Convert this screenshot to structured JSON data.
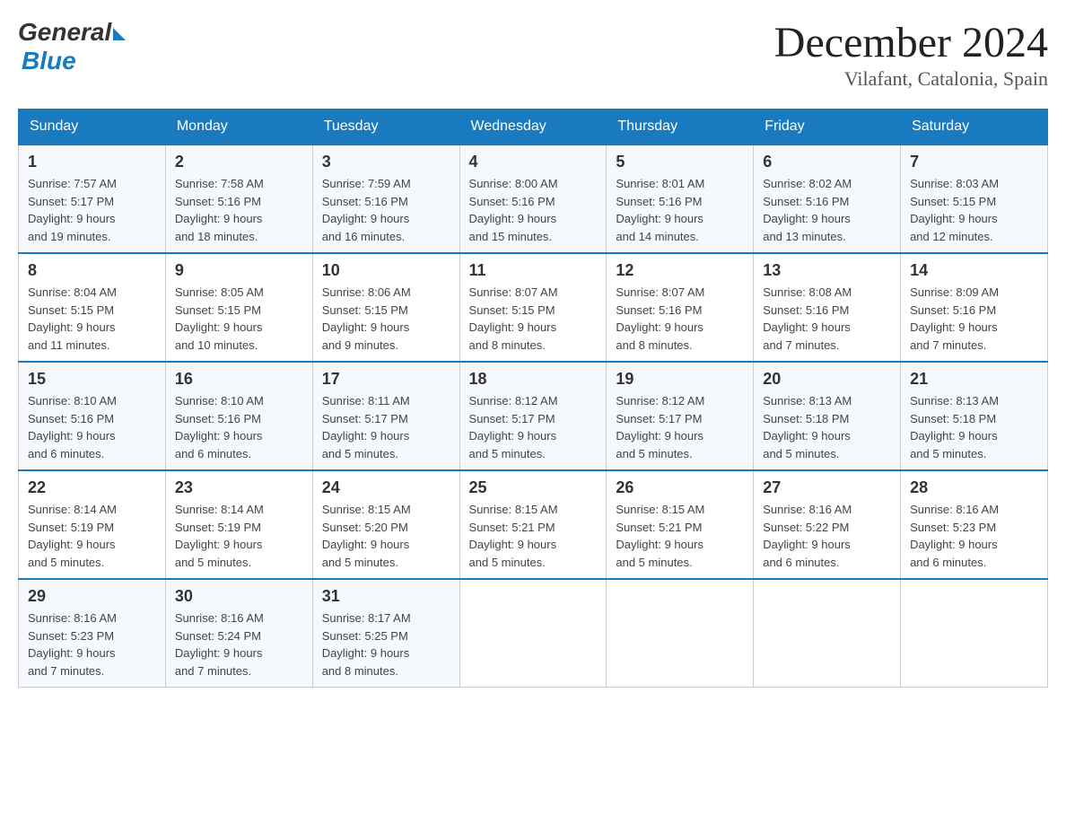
{
  "header": {
    "logo_general": "General",
    "logo_blue": "Blue",
    "month_title": "December 2024",
    "location": "Vilafant, Catalonia, Spain"
  },
  "weekdays": [
    "Sunday",
    "Monday",
    "Tuesday",
    "Wednesday",
    "Thursday",
    "Friday",
    "Saturday"
  ],
  "weeks": [
    [
      {
        "day": "1",
        "sunrise": "7:57 AM",
        "sunset": "5:17 PM",
        "daylight": "9 hours and 19 minutes."
      },
      {
        "day": "2",
        "sunrise": "7:58 AM",
        "sunset": "5:16 PM",
        "daylight": "9 hours and 18 minutes."
      },
      {
        "day": "3",
        "sunrise": "7:59 AM",
        "sunset": "5:16 PM",
        "daylight": "9 hours and 16 minutes."
      },
      {
        "day": "4",
        "sunrise": "8:00 AM",
        "sunset": "5:16 PM",
        "daylight": "9 hours and 15 minutes."
      },
      {
        "day": "5",
        "sunrise": "8:01 AM",
        "sunset": "5:16 PM",
        "daylight": "9 hours and 14 minutes."
      },
      {
        "day": "6",
        "sunrise": "8:02 AM",
        "sunset": "5:16 PM",
        "daylight": "9 hours and 13 minutes."
      },
      {
        "day": "7",
        "sunrise": "8:03 AM",
        "sunset": "5:15 PM",
        "daylight": "9 hours and 12 minutes."
      }
    ],
    [
      {
        "day": "8",
        "sunrise": "8:04 AM",
        "sunset": "5:15 PM",
        "daylight": "9 hours and 11 minutes."
      },
      {
        "day": "9",
        "sunrise": "8:05 AM",
        "sunset": "5:15 PM",
        "daylight": "9 hours and 10 minutes."
      },
      {
        "day": "10",
        "sunrise": "8:06 AM",
        "sunset": "5:15 PM",
        "daylight": "9 hours and 9 minutes."
      },
      {
        "day": "11",
        "sunrise": "8:07 AM",
        "sunset": "5:15 PM",
        "daylight": "9 hours and 8 minutes."
      },
      {
        "day": "12",
        "sunrise": "8:07 AM",
        "sunset": "5:16 PM",
        "daylight": "9 hours and 8 minutes."
      },
      {
        "day": "13",
        "sunrise": "8:08 AM",
        "sunset": "5:16 PM",
        "daylight": "9 hours and 7 minutes."
      },
      {
        "day": "14",
        "sunrise": "8:09 AM",
        "sunset": "5:16 PM",
        "daylight": "9 hours and 7 minutes."
      }
    ],
    [
      {
        "day": "15",
        "sunrise": "8:10 AM",
        "sunset": "5:16 PM",
        "daylight": "9 hours and 6 minutes."
      },
      {
        "day": "16",
        "sunrise": "8:10 AM",
        "sunset": "5:16 PM",
        "daylight": "9 hours and 6 minutes."
      },
      {
        "day": "17",
        "sunrise": "8:11 AM",
        "sunset": "5:17 PM",
        "daylight": "9 hours and 5 minutes."
      },
      {
        "day": "18",
        "sunrise": "8:12 AM",
        "sunset": "5:17 PM",
        "daylight": "9 hours and 5 minutes."
      },
      {
        "day": "19",
        "sunrise": "8:12 AM",
        "sunset": "5:17 PM",
        "daylight": "9 hours and 5 minutes."
      },
      {
        "day": "20",
        "sunrise": "8:13 AM",
        "sunset": "5:18 PM",
        "daylight": "9 hours and 5 minutes."
      },
      {
        "day": "21",
        "sunrise": "8:13 AM",
        "sunset": "5:18 PM",
        "daylight": "9 hours and 5 minutes."
      }
    ],
    [
      {
        "day": "22",
        "sunrise": "8:14 AM",
        "sunset": "5:19 PM",
        "daylight": "9 hours and 5 minutes."
      },
      {
        "day": "23",
        "sunrise": "8:14 AM",
        "sunset": "5:19 PM",
        "daylight": "9 hours and 5 minutes."
      },
      {
        "day": "24",
        "sunrise": "8:15 AM",
        "sunset": "5:20 PM",
        "daylight": "9 hours and 5 minutes."
      },
      {
        "day": "25",
        "sunrise": "8:15 AM",
        "sunset": "5:21 PM",
        "daylight": "9 hours and 5 minutes."
      },
      {
        "day": "26",
        "sunrise": "8:15 AM",
        "sunset": "5:21 PM",
        "daylight": "9 hours and 5 minutes."
      },
      {
        "day": "27",
        "sunrise": "8:16 AM",
        "sunset": "5:22 PM",
        "daylight": "9 hours and 6 minutes."
      },
      {
        "day": "28",
        "sunrise": "8:16 AM",
        "sunset": "5:23 PM",
        "daylight": "9 hours and 6 minutes."
      }
    ],
    [
      {
        "day": "29",
        "sunrise": "8:16 AM",
        "sunset": "5:23 PM",
        "daylight": "9 hours and 7 minutes."
      },
      {
        "day": "30",
        "sunrise": "8:16 AM",
        "sunset": "5:24 PM",
        "daylight": "9 hours and 7 minutes."
      },
      {
        "day": "31",
        "sunrise": "8:17 AM",
        "sunset": "5:25 PM",
        "daylight": "9 hours and 8 minutes."
      },
      null,
      null,
      null,
      null
    ]
  ],
  "labels": {
    "sunrise": "Sunrise:",
    "sunset": "Sunset:",
    "daylight": "Daylight:"
  }
}
